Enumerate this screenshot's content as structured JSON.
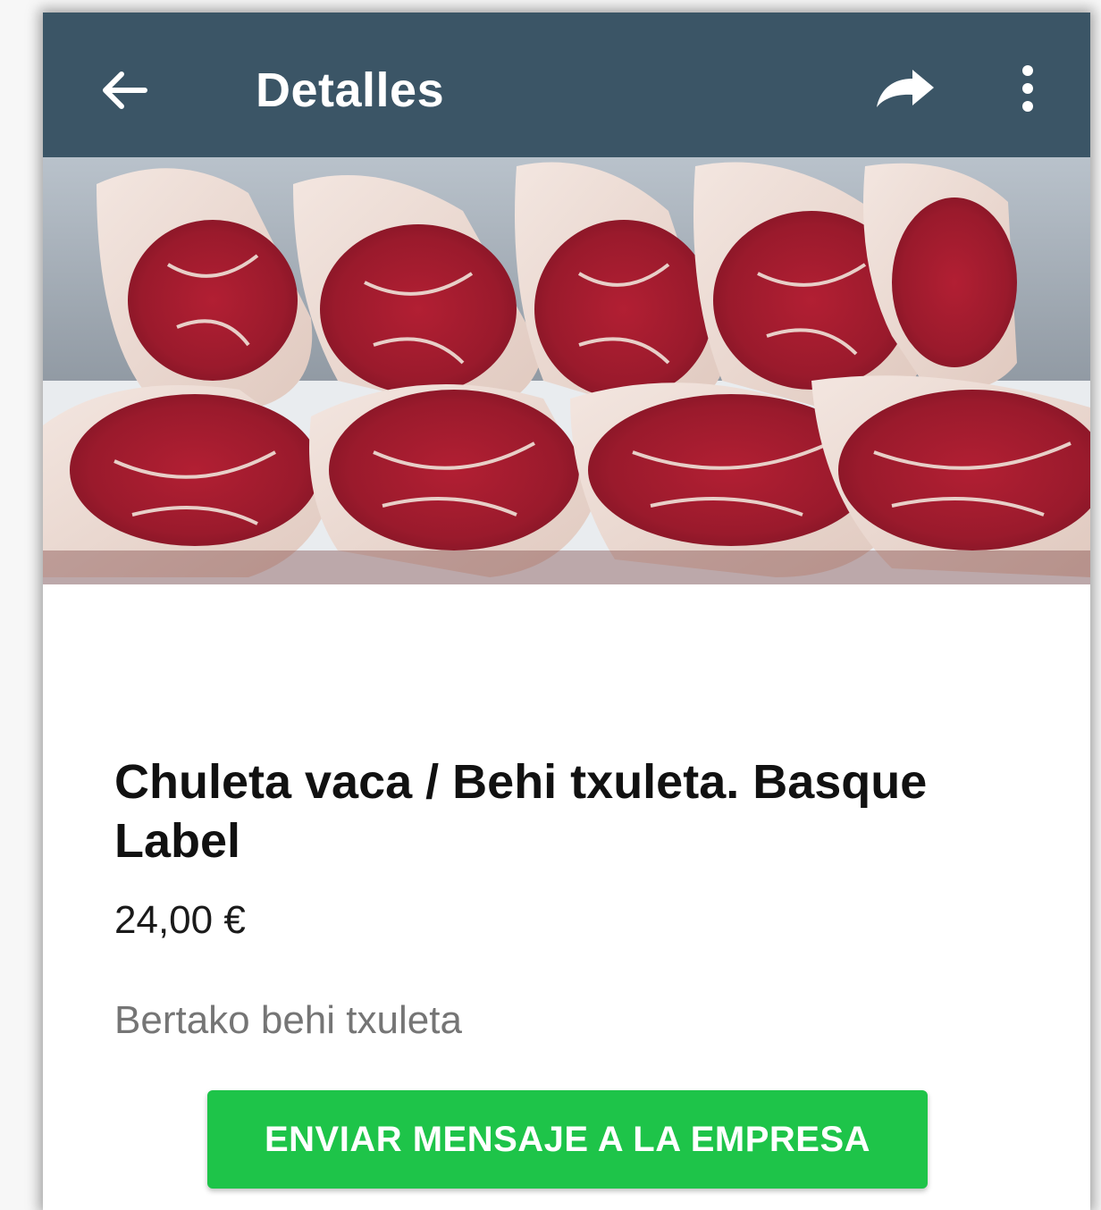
{
  "appbar": {
    "title": "Detalles",
    "back_icon": "arrow-left-icon",
    "share_icon": "share-icon",
    "more_icon": "more-vertical-icon",
    "background_color": "#3b5566"
  },
  "product": {
    "image_alt": "beef-ribeye-steaks-photo",
    "name": "Chuleta vaca / Behi txuleta. Basque Label",
    "price": "24,00 €",
    "description": "Bertako behi txuleta"
  },
  "actions": {
    "contact_button_label": "ENVIAR MENSAJE A LA EMPRESA",
    "contact_button_color": "#1ec449"
  }
}
